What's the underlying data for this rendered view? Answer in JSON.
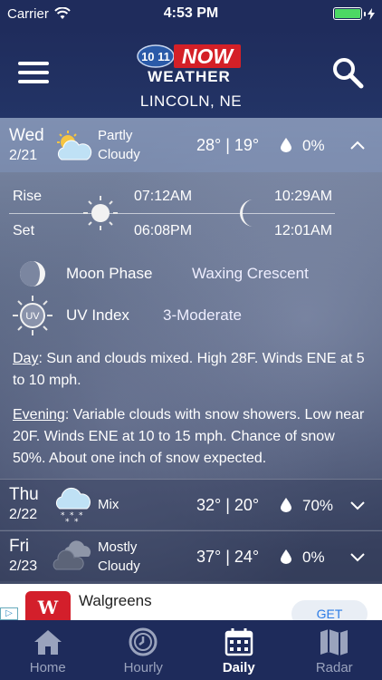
{
  "status": {
    "carrier": "Carrier",
    "time": "4:53 PM"
  },
  "header": {
    "logo_channel": "10 11",
    "logo_now": "NOW",
    "logo_weather": "WEATHER",
    "city": "LINCOLN, NE"
  },
  "days": [
    {
      "name": "Wed",
      "date": "2/21",
      "icon": "partly-cloudy-icon",
      "cond1": "Partly",
      "cond2": "Cloudy",
      "temps": "28° | 19°",
      "precip": "0%"
    },
    {
      "name": "Thu",
      "date": "2/22",
      "icon": "snow-cloud-icon",
      "cond1": "Mix",
      "cond2": "",
      "temps": "32° | 20°",
      "precip": "70%"
    },
    {
      "name": "Fri",
      "date": "2/23",
      "icon": "mostly-cloudy-icon",
      "cond1": "Mostly",
      "cond2": "Cloudy",
      "temps": "37° | 24°",
      "precip": "0%"
    }
  ],
  "detail": {
    "rise_label": "Rise",
    "set_label": "Set",
    "sunrise": "07:12AM",
    "sunset": "06:08PM",
    "moonrise": "10:29AM",
    "moonset": "12:01AM",
    "moon_phase_label": "Moon Phase",
    "moon_phase_value": "Waxing Crescent",
    "uv_label": "UV Index",
    "uv_icon_text": "UV",
    "uv_value": "3-Moderate",
    "day_label": "Day",
    "day_text": ": Sun and clouds mixed. High 28F. Winds ENE at 5 to 10 mph.",
    "evening_label": "Evening",
    "evening_text": ": Variable clouds with snow showers. Low near 20F. Winds ENE at 10 to 15 mph. Chance of snow 50%. About one inch of snow expected."
  },
  "ad": {
    "info": "▷",
    "logo_text": "W",
    "name": "Walgreens",
    "button": "GET"
  },
  "tabs": [
    {
      "label": "Home",
      "icon": "home-icon"
    },
    {
      "label": "Hourly",
      "icon": "clock-icon"
    },
    {
      "label": "Daily",
      "icon": "calendar-icon"
    },
    {
      "label": "Radar",
      "icon": "map-icon"
    }
  ],
  "colors": {
    "bar": "#1f2c5c",
    "battery": "#4cd964",
    "ad_brand": "#d31f2b",
    "get_button": "#2b7ce6"
  }
}
